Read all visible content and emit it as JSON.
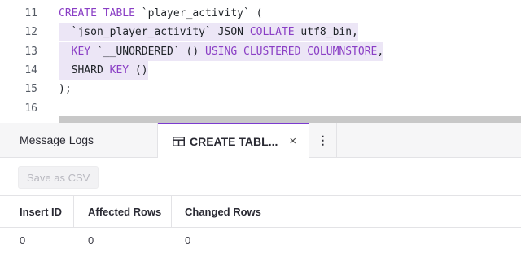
{
  "editor": {
    "lines": [
      {
        "number": "11",
        "parts": [
          {
            "t": "CREATE TABLE",
            "kw": true
          },
          {
            "t": " `player_activity` (",
            "kw": false
          }
        ]
      },
      {
        "number": "12",
        "parts": [
          {
            "t": "  `json_player_activity` JSON ",
            "kw": false
          },
          {
            "t": "COLLATE",
            "kw": true
          },
          {
            "t": " utf8_bin,",
            "kw": false
          }
        ]
      },
      {
        "number": "13",
        "parts": [
          {
            "t": "  ",
            "kw": false
          },
          {
            "t": "KEY",
            "kw": true
          },
          {
            "t": " `__UNORDERED` () ",
            "kw": false
          },
          {
            "t": "USING CLUSTERED COLUMNSTORE",
            "kw": true
          },
          {
            "t": ",",
            "kw": false
          }
        ]
      },
      {
        "number": "14",
        "parts": [
          {
            "t": "  SHARD ",
            "kw": false
          },
          {
            "t": "KEY",
            "kw": true
          },
          {
            "t": " ()",
            "kw": false
          }
        ]
      },
      {
        "number": "15",
        "parts": [
          {
            "t": ");",
            "kw": false
          }
        ]
      },
      {
        "number": "16",
        "parts": []
      }
    ]
  },
  "tabs": {
    "logs_label": "Message Logs",
    "active_label": "CREATE TABL...",
    "close_glyph": "×",
    "more_glyph": "⋮"
  },
  "toolbar": {
    "save_label": "Save as CSV"
  },
  "results": {
    "columns": [
      "Insert ID",
      "Affected Rows",
      "Changed Rows"
    ],
    "rows": [
      [
        "0",
        "0",
        "0"
      ]
    ]
  },
  "colors": {
    "accent": "#7c3bd0",
    "keyword": "#8a3ec5",
    "highlight": "#ece6f6"
  }
}
